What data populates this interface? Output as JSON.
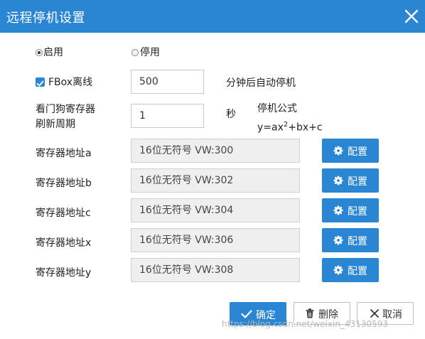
{
  "dialog": {
    "title": "远程停机设置",
    "close_icon": "close-icon"
  },
  "mode": {
    "enable_label": "启用",
    "disable_label": "停用",
    "selected": "启用"
  },
  "fbox_offline": {
    "checked": true,
    "label": "FBox离线",
    "value": "500",
    "suffix": "分钟后自动停机"
  },
  "watchdog": {
    "label_line1": "看门狗寄存器",
    "label_line2": "刷新周期",
    "value": "1",
    "unit": "秒"
  },
  "formula": {
    "title": "停机公式",
    "expr_before_sup": "y=ax",
    "sup": "2",
    "expr_after_sup": "+bx+c"
  },
  "registers": [
    {
      "label": "寄存器地址a",
      "value": "16位无符号 VW:300",
      "button": "配置"
    },
    {
      "label": "寄存器地址b",
      "value": "16位无符号 VW:302",
      "button": "配置"
    },
    {
      "label": "寄存器地址c",
      "value": "16位无符号 VW:304",
      "button": "配置"
    },
    {
      "label": "寄存器地址x",
      "value": "16位无符号 VW:306",
      "button": "配置"
    },
    {
      "label": "寄存器地址y",
      "value": "16位无符号 VW:308",
      "button": "配置"
    }
  ],
  "footer": {
    "confirm": "确定",
    "delete": "删除",
    "cancel": "取消"
  },
  "watermark": "https://blog.csdn.net/weixin_43130593",
  "colors": {
    "accent": "#2a86d3",
    "readonly_bg": "#efefef",
    "watermark": "#b9b9b9"
  }
}
